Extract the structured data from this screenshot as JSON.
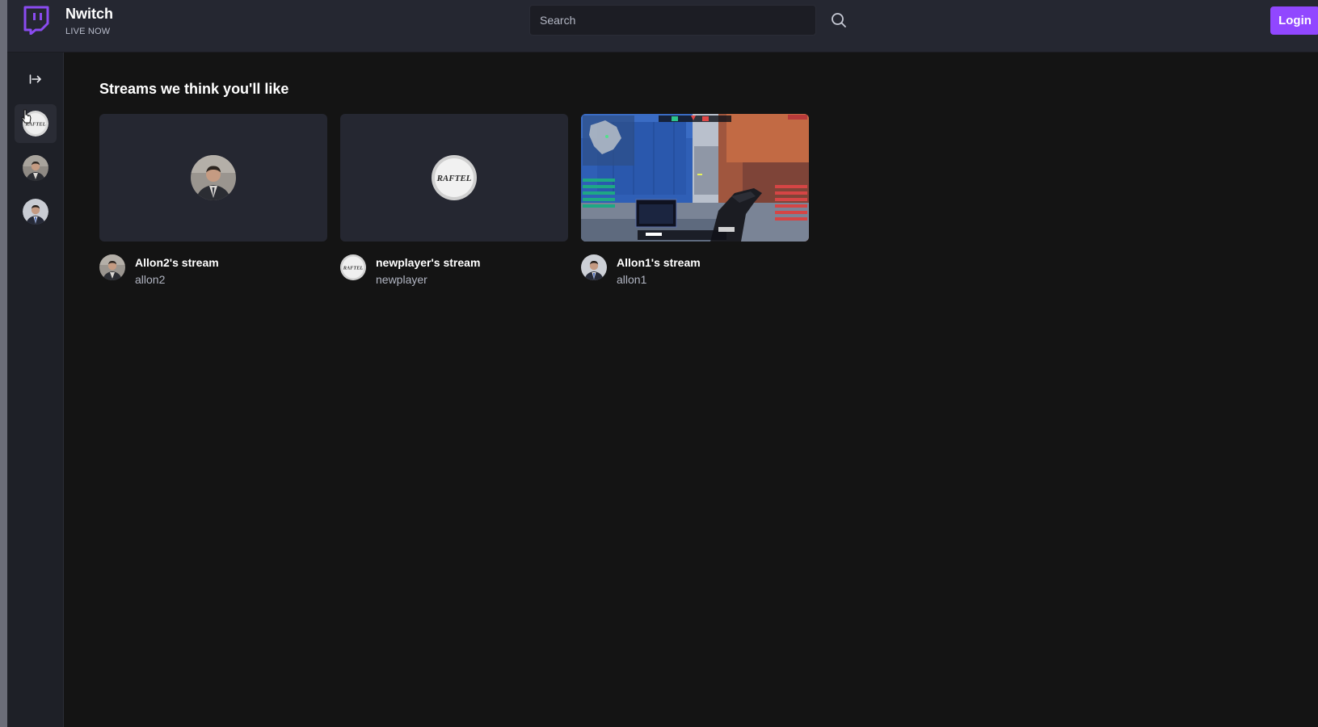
{
  "app": {
    "name": "Nwitch",
    "subtitle": "LIVE NOW"
  },
  "search": {
    "placeholder": "Search",
    "value": ""
  },
  "header": {
    "login_label": "Login"
  },
  "colors": {
    "accent": "#9147ff",
    "background": "#141414",
    "topbar": "#252731",
    "sidebar": "#1e2027",
    "card_placeholder": "#252731"
  },
  "sidebar": {
    "expand_icon": "expand-right-icon",
    "channels": [
      {
        "name": "newplayer",
        "avatar": "raftel-logo",
        "active": true
      },
      {
        "name": "allon2",
        "avatar": "man-in-suit"
      },
      {
        "name": "allon1",
        "avatar": "man-in-suit-blue-tie"
      }
    ]
  },
  "main": {
    "section_title": "Streams we think you'll like",
    "streams": [
      {
        "title": "Allon2's stream",
        "user": "allon2",
        "thumbnail": "offline-avatar",
        "avatar": "man-in-suit"
      },
      {
        "title": "newplayer's stream",
        "user": "newplayer",
        "thumbnail": "offline-avatar",
        "avatar": "raftel-logo",
        "logo_text": "RAFTEL"
      },
      {
        "title": "Allon1's stream",
        "user": "allon1",
        "thumbnail": "live-gameplay",
        "avatar": "man-in-suit-blue-tie"
      }
    ]
  }
}
